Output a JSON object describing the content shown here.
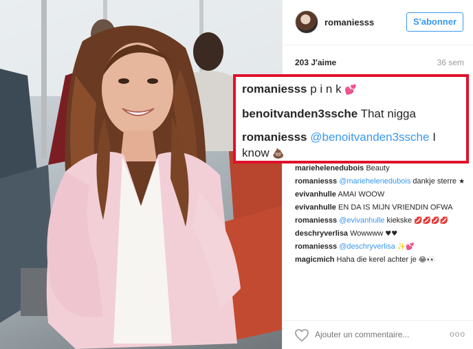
{
  "header": {
    "username": "romaniesss",
    "follow_label": "S'abonner"
  },
  "stats": {
    "likes": "203 J'aime",
    "time": "36 sem"
  },
  "highlighted_comments": [
    {
      "user": "romaniesss",
      "text": "p i n k",
      "emoji": "💕"
    },
    {
      "user": "benoitvanden3ssche",
      "text": "That nigga"
    },
    {
      "user": "romaniesss",
      "mention": "@benoitvanden3ssche",
      "text": "I know",
      "emoji": "💩"
    }
  ],
  "comments": [
    {
      "user": "mariehelenedubois",
      "text": "Beauty"
    },
    {
      "user": "romaniesss",
      "mention": "@mariehelenedubois",
      "text": "dankje sterre",
      "emoji": "★"
    },
    {
      "user": "evivanhulle",
      "text": "AMAI WOOW"
    },
    {
      "user": "evivanhulle",
      "text": "EN DA IS MIJN VRIENDIN OFWA"
    },
    {
      "user": "romaniesss",
      "mention": "@evivanhulle",
      "text": "kiekske",
      "emoji": "💋💋💋💋"
    },
    {
      "user": "deschryverlisa",
      "text": "Wowwww",
      "emoji": "♥♥"
    },
    {
      "user": "romaniesss",
      "mention": "@deschryverlisa",
      "emoji": "✨💕"
    },
    {
      "user": "magicmich",
      "text": "Haha die kerel achter je",
      "emoji": "😂👀"
    }
  ],
  "footer": {
    "comment_placeholder": "Ajouter un commentaire...",
    "more_label": "ooo"
  },
  "colors": {
    "highlight_border": "#e0102a",
    "link": "#3897f0"
  }
}
